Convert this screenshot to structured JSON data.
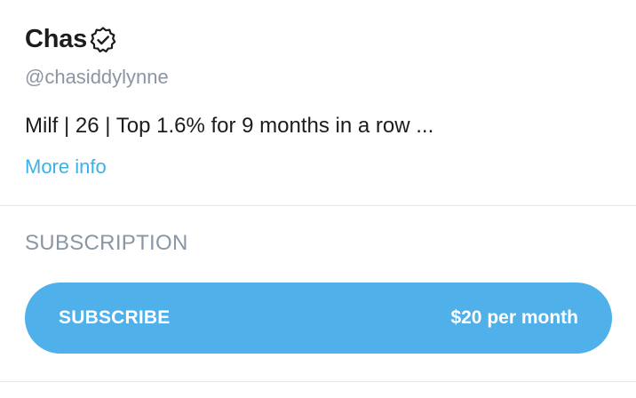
{
  "profile": {
    "name": "Chas",
    "verified_icon": "verified-badge-icon",
    "handle": "@chasiddylynne",
    "bio": "Milf | 26 | Top 1.6% for 9 months in a row ...",
    "more_info_label": "More info"
  },
  "subscription": {
    "section_title": "SUBSCRIPTION",
    "button_label": "SUBSCRIBE",
    "price_label": "$20 per month"
  },
  "colors": {
    "accent": "#4fb0ea",
    "link": "#3cb0e8",
    "muted": "#8a96a3",
    "text": "#1c1c1c",
    "divider": "#e6e8ea"
  }
}
